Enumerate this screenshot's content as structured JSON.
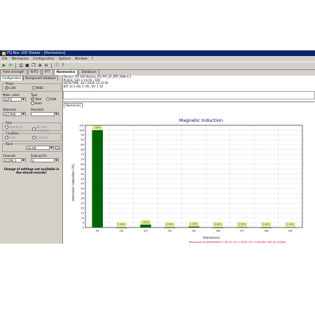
{
  "window": {
    "title": "PQ-Box 100 Viewer - [Harmonics]"
  },
  "menu": [
    "File",
    "Workspace",
    "Configuration",
    "Options",
    "Window",
    "?"
  ],
  "tabs": [
    {
      "label": "Field strength"
    },
    {
      "label": "N-TO"
    },
    {
      "label": "FFT"
    },
    {
      "label": "Harmonics"
    },
    {
      "label": "Database"
    }
  ],
  "left": {
    "subtabs": [
      "Configuration",
      "Background database"
    ],
    "phase_group": "Phase",
    "phase_options": [
      "L1/N",
      "N/N2"
    ],
    "measurement_label": "Meas. value",
    "measurement_value": "AUTO",
    "type_label": "Type",
    "type_options": [
      "Total",
      "Odd",
      "Even"
    ],
    "detection_label": "Detection",
    "detection_value": "ACT.PAR",
    "standard_label": "Standard",
    "standard_value": "",
    "filter_group": "Filter",
    "filter_options": [
      "Spectrum",
      "No filter, harmonic"
    ],
    "condition_group": "Condition",
    "condition_options": [
      "Limit",
      "Function"
    ],
    "band_group": "Band",
    "band_value": "H1-H9",
    "channels_label": "Channels",
    "channels_value": "SCOPE 1",
    "scale_label": "Scaling (%)",
    "scale_value": "4",
    "note": "Change of settings not available in the stored records!"
  },
  "main": {
    "info_lines": [
      "Device: PQ 100 Nomas_PQ.TPF_ST_PRT_RHH 4.1",
      "PLACE: S10 1 V.0.05 / 100",
      "DATE/TIME: 30.7.2020 13:12:50",
      "BIT: UI 1 AIG 1: PA_ VV: 1 10"
    ],
    "harmonics_tab": "Harmonics"
  },
  "chart_data": {
    "type": "bar",
    "title": "Magnetic Induction",
    "xlabel": "Harmonics",
    "ylabel": "Harmonic Induction [%]",
    "categories": [
      "H1",
      "H2",
      "H3",
      "H4",
      "H5",
      "H6",
      "H7",
      "H8",
      "H9"
    ],
    "values": [
      100,
      0,
      3,
      0,
      1,
      0,
      0.5,
      0,
      0.3
    ],
    "data_labels": [
      "100%",
      "0.00%",
      "3.00%",
      "0.00%",
      "1.00%",
      "0.00%",
      "0.50%",
      "0.00%",
      "0.30%"
    ],
    "ylim": [
      0,
      105
    ],
    "yticks": [
      0,
      5,
      10,
      15,
      20,
      25,
      30,
      35,
      40,
      45,
      50,
      55,
      60,
      65,
      70,
      75,
      80,
      85,
      90,
      95,
      100,
      105
    ],
    "grid": true,
    "bar_color": "#006400",
    "label_bg": "#ffff99",
    "title_color": "#00008b",
    "footer": "Measured fundamental H: 40.07 ;01.2.2020 ;VT: 1:40005s ;RR at 11k60s"
  }
}
